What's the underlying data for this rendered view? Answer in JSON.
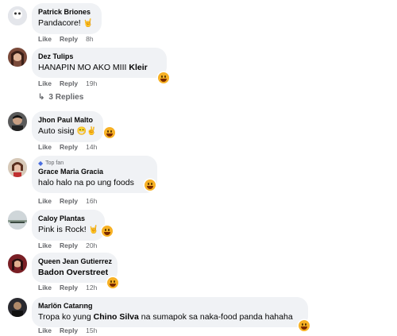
{
  "actions": {
    "like": "Like",
    "reply": "Reply"
  },
  "comments": [
    {
      "author": "Patrick Briones",
      "text": "Pandacore!",
      "emoji": "🤘",
      "time": "8h",
      "reaction": "haha-reaction-icon"
    },
    {
      "author": "Dez Tulips",
      "text_prefix": "HANAPIN MO AKO MIII",
      "mention": "Kleir",
      "time": "19h",
      "reaction": "haha-reaction-icon"
    },
    {
      "author": "Jhon Paul Malto",
      "text": "Auto sisig",
      "emoji": "😁✌",
      "time": "14h",
      "reaction": "haha-reaction-icon"
    },
    {
      "badge": "Top fan",
      "author": "Grace Maria Gracia",
      "text": "halo halo na po ung foods",
      "time": "16h",
      "reaction": "haha-reaction-icon"
    },
    {
      "author": "Caloy Plantas",
      "text": "Pink is Rock!",
      "emoji": "🤘",
      "time": "20h",
      "reaction": "haha-reaction-icon"
    },
    {
      "author": "Queen Jean Gutierrez",
      "mention": "Badon Overstreet",
      "time": "12h",
      "reaction": "haha-reaction-icon"
    },
    {
      "author": "Marlön Catarıng",
      "text_prefix": "Tropa ko yung",
      "mention": "Chino Silva",
      "text_suffix": "na sumapok sa naka-food panda hahaha",
      "time": "15h",
      "reaction": "haha-reaction-icon"
    }
  ],
  "replies_link": "3 Replies",
  "colors": {
    "bubble": "#f0f2f5",
    "meta": "#65676b",
    "reaction": "#f7b125"
  }
}
